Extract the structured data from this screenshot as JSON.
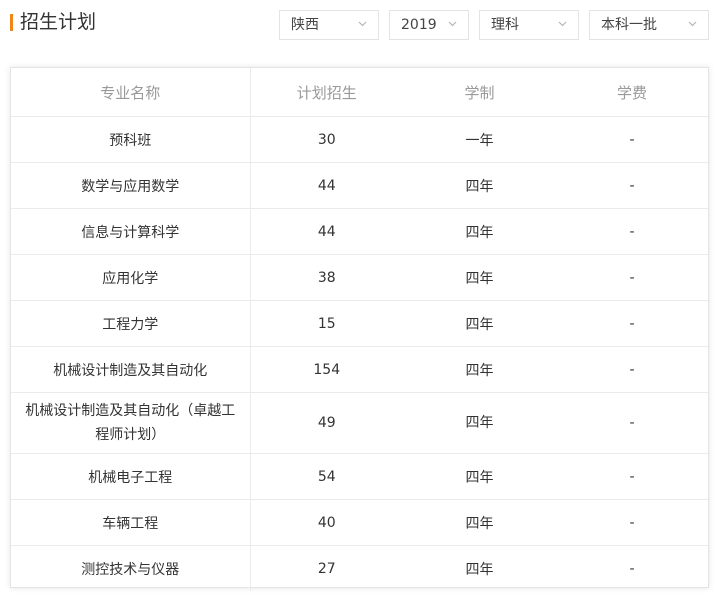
{
  "header": {
    "title": "招生计划",
    "accent_color": "#f08519"
  },
  "filters": {
    "province": "陕西",
    "year": "2019",
    "subject": "理科",
    "batch": "本科一批",
    "chevron_icon": "chevron-down-icon"
  },
  "table": {
    "columns": [
      "专业名称",
      "计划招生",
      "学制",
      "学费"
    ],
    "rows": [
      {
        "major": "预科班",
        "plan": "30",
        "duration": "一年",
        "fee": "-"
      },
      {
        "major": "数学与应用数学",
        "plan": "44",
        "duration": "四年",
        "fee": "-"
      },
      {
        "major": "信息与计算科学",
        "plan": "44",
        "duration": "四年",
        "fee": "-"
      },
      {
        "major": "应用化学",
        "plan": "38",
        "duration": "四年",
        "fee": "-"
      },
      {
        "major": "工程力学",
        "plan": "15",
        "duration": "四年",
        "fee": "-"
      },
      {
        "major": "机械设计制造及其自动化",
        "plan": "154",
        "duration": "四年",
        "fee": "-"
      },
      {
        "major": "机械设计制造及其自动化（卓越工程师计划）",
        "plan": "49",
        "duration": "四年",
        "fee": "-"
      },
      {
        "major": "机械电子工程",
        "plan": "54",
        "duration": "四年",
        "fee": "-"
      },
      {
        "major": "车辆工程",
        "plan": "40",
        "duration": "四年",
        "fee": "-"
      },
      {
        "major": "测控技术与仪器",
        "plan": "27",
        "duration": "四年",
        "fee": "-"
      }
    ]
  }
}
